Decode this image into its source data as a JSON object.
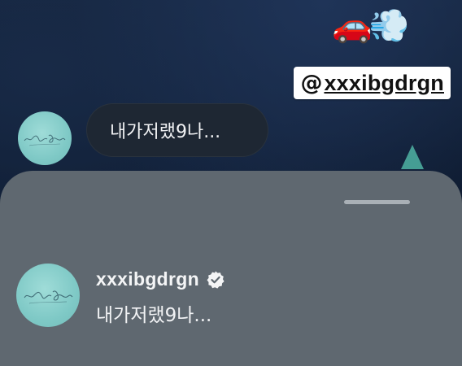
{
  "story": {
    "sticker_emoji": "🚗💨",
    "mention": {
      "icon": "threads-icon",
      "icon_glyph": "@",
      "handle": "xxxibgdrgn"
    },
    "reply_bubble_text": "내가저랬9나..."
  },
  "sheet": {
    "username": "xxxibgdrgn",
    "verified": true,
    "message": "내가저랬9나..."
  },
  "colors": {
    "sheet_bg": "#5f6870",
    "avatar_teal": "#7fc9c6",
    "story_bg": "#0e1b30",
    "accent_glow": "#4fb3a3"
  }
}
